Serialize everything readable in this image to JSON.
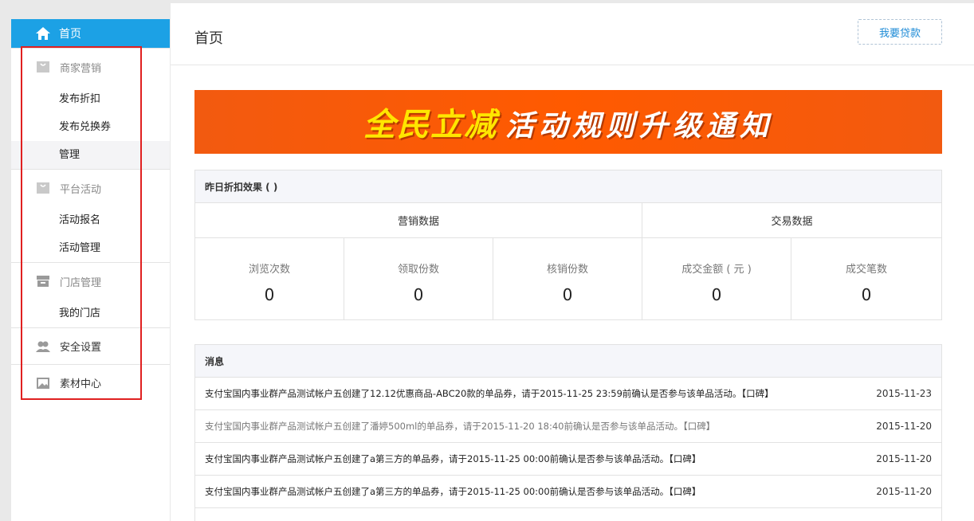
{
  "sidebar": {
    "home_label": "首页",
    "groups": [
      {
        "title": "商家营销",
        "items": [
          "发布折扣",
          "发布兑换券",
          "管理"
        ]
      },
      {
        "title": "平台活动",
        "items": [
          "活动报名",
          "活动管理"
        ]
      },
      {
        "title": "门店管理",
        "items": [
          "我的门店"
        ]
      }
    ],
    "security_label": "安全设置",
    "material_label": "素材中心"
  },
  "header": {
    "title": "首页",
    "loan_button": "我要贷款"
  },
  "banner": {
    "highlight": "全民立减",
    "text": "活动规则升级通知"
  },
  "stats": {
    "title": "昨日折扣效果 ( )",
    "group_marketing": "营销数据",
    "group_trade": "交易数据",
    "metrics": [
      {
        "label": "浏览次数",
        "value": "0"
      },
      {
        "label": "领取份数",
        "value": "0"
      },
      {
        "label": "核销份数",
        "value": "0"
      },
      {
        "label": "成交金额 ( 元 )",
        "value": "0"
      },
      {
        "label": "成交笔数",
        "value": "0"
      }
    ]
  },
  "messages": {
    "title": "消息",
    "rows": [
      {
        "text": "支付宝国内事业群产品测试帐户五创建了12.12优惠商品-ABC20款的单品券，请于2015-11-25 23:59前确认是否参与该单品活动。【口碑】",
        "date": "2015-11-23"
      },
      {
        "text": "支付宝国内事业群产品测试帐户五创建了潘婷500ml的单品券，请于2015-11-20 18:40前确认是否参与该单品活动。【口碑】",
        "date": "2015-11-20"
      },
      {
        "text": "支付宝国内事业群产品测试帐户五创建了a第三方的单品券，请于2015-11-25 00:00前确认是否参与该单品活动。【口碑】",
        "date": "2015-11-20"
      },
      {
        "text": "支付宝国内事业群产品测试帐户五创建了a第三方的单品券，请于2015-11-25 00:00前确认是否参与该单品活动。【口碑】",
        "date": "2015-11-20"
      }
    ]
  }
}
